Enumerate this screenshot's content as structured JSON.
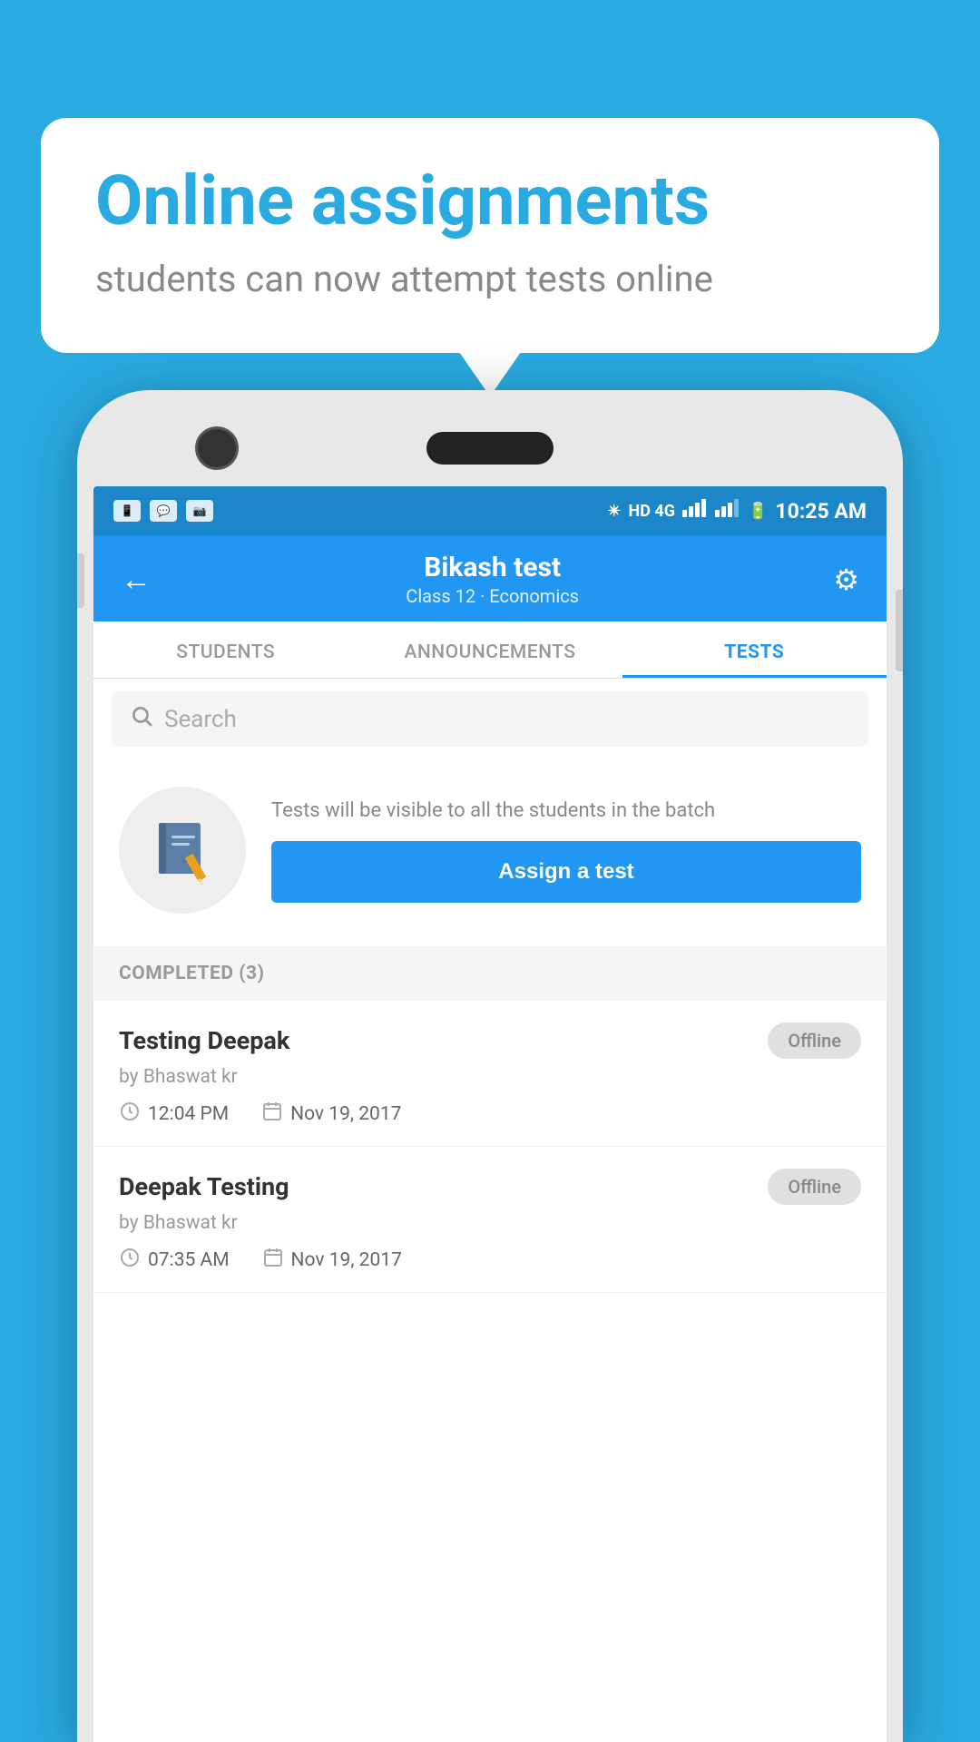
{
  "background_color": "#29ABE2",
  "bubble": {
    "title": "Online assignments",
    "subtitle": "students can now attempt tests online"
  },
  "status_bar": {
    "time": "10:25 AM",
    "network": "HD 4G",
    "icons": [
      "app1",
      "whatsapp",
      "photo"
    ]
  },
  "app_bar": {
    "title": "Bikash test",
    "subtitle": "Class 12 · Economics",
    "back_label": "←",
    "settings_label": "⚙"
  },
  "tabs": [
    {
      "label": "STUDENTS",
      "active": false
    },
    {
      "label": "ANNOUNCEMENTS",
      "active": false
    },
    {
      "label": "TESTS",
      "active": true
    }
  ],
  "search": {
    "placeholder": "Search",
    "icon": "search"
  },
  "assign_section": {
    "description": "Tests will be visible to all the students in the batch",
    "button_label": "Assign a test"
  },
  "completed_section": {
    "header": "COMPLETED (3)",
    "items": [
      {
        "title": "Testing Deepak",
        "by": "by Bhaswat kr",
        "time": "12:04 PM",
        "date": "Nov 19, 2017",
        "status": "Offline"
      },
      {
        "title": "Deepak Testing",
        "by": "by Bhaswat kr",
        "time": "07:35 AM",
        "date": "Nov 19, 2017",
        "status": "Offline"
      }
    ]
  }
}
